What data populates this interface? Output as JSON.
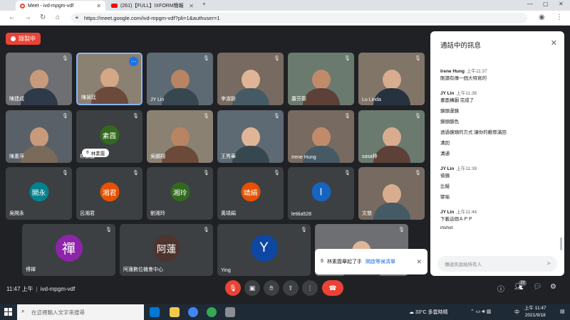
{
  "browser": {
    "tabs": [
      {
        "title": "Meet - ivd-mpgm-vdf"
      },
      {
        "title": "(261)【FULL】IXFORM簡報"
      }
    ],
    "url": "https://meet.google.com/ivd-mpgm-vdf?pli=1&authuser=1",
    "new_tab": "+",
    "win_min": "—",
    "win_max": "▢",
    "win_close": "✕"
  },
  "meet": {
    "recording_label": "錄製中",
    "meeting_time": "11:47 上午",
    "meeting_code": "ivd-mpgm-vdf",
    "participant_count": "22",
    "raise_hand_pill": "林素霞",
    "colors": {
      "accent": "#1a73e8",
      "danger": "#ea4335",
      "surface": "#3c4043"
    }
  },
  "tiles": [
    {
      "name": "陳建成",
      "type": "video"
    },
    {
      "name": "陳昶廷",
      "type": "video"
    },
    {
      "name": "JY Lin",
      "type": "video"
    },
    {
      "name": "李淑齡",
      "type": "video"
    },
    {
      "name": "蕭芬鄭",
      "type": "video"
    },
    {
      "name": "Lu Linda",
      "type": "video"
    },
    {
      "name": "陳惠萍",
      "type": "video"
    },
    {
      "name": "林素霞",
      "type": "avatar",
      "initial": "素霞",
      "color": "#33691e"
    },
    {
      "name": "吳鵬翔",
      "type": "video"
    },
    {
      "name": "王秀華",
      "type": "video"
    },
    {
      "name": "Irene Hung",
      "type": "video"
    },
    {
      "name": "sasa林",
      "type": "video"
    },
    {
      "name": "吳開永",
      "type": "avatar",
      "initial": "開永",
      "color": "#00838f"
    },
    {
      "name": "呂湘君",
      "type": "avatar",
      "initial": "湘君",
      "color": "#e65100"
    },
    {
      "name": "劉湘玲",
      "type": "avatar",
      "initial": "湘玲",
      "color": "#33691e"
    },
    {
      "name": "黃靖絹",
      "type": "avatar",
      "initial": "靖絹",
      "color": "#e65100"
    },
    {
      "name": "letitia528",
      "type": "avatar",
      "initial": "l",
      "color": "#1565c0"
    },
    {
      "name": "文慈",
      "type": "video"
    },
    {
      "name": "傅禪",
      "type": "avatar",
      "initial": "禪",
      "color": "#8e24aa"
    },
    {
      "name": "阿蓮數位機會中心",
      "type": "avatar",
      "initial": "阿蓮",
      "color": "#4e342e"
    },
    {
      "name": "Ying",
      "type": "avatar",
      "initial": "Y",
      "color": "#0d47a1"
    },
    {
      "name": "",
      "type": "video"
    }
  ],
  "chat": {
    "title": "通話中的訊息",
    "input_placeholder": "傳送訊息給所有人",
    "messages": [
      {
        "kind": "header",
        "sender": "Irene Hung",
        "time": "上午11:37"
      },
      {
        "kind": "text",
        "text": "剛讀有傳一個大特寫的"
      },
      {
        "kind": "header",
        "sender": "JY Lin",
        "time": "上午11:38"
      },
      {
        "kind": "text",
        "text": "畫面構圖 完成了"
      },
      {
        "kind": "text",
        "text": "鏡頭運鏡"
      },
      {
        "kind": "text",
        "text": "鏡頭腦色"
      },
      {
        "kind": "text",
        "text": "透過鏡頭的方式 讓你的觀眾滿回"
      },
      {
        "kind": "text",
        "text": "溝回"
      },
      {
        "kind": "text",
        "text": "溝通"
      },
      {
        "kind": "header",
        "sender": "JY Lin",
        "time": "上午11:39"
      },
      {
        "kind": "text",
        "text": "借鏡"
      },
      {
        "kind": "text",
        "text": "比擬"
      },
      {
        "kind": "text",
        "text": "譬喻"
      },
      {
        "kind": "header",
        "sender": "JY Lin",
        "time": "上午11:44"
      },
      {
        "kind": "text",
        "text": "下載這個ＡＰＰ"
      },
      {
        "kind": "text",
        "text": "inshot"
      }
    ]
  },
  "toast": {
    "text": "林素霞舉起了手",
    "link": "開啟等候清單"
  },
  "taskbar": {
    "search_placeholder": "在這裡輸入文字來搜尋",
    "weather": "33°C 多雲時晴",
    "ime": "中",
    "time": "上午 11:47",
    "date": "2021/9/18"
  }
}
